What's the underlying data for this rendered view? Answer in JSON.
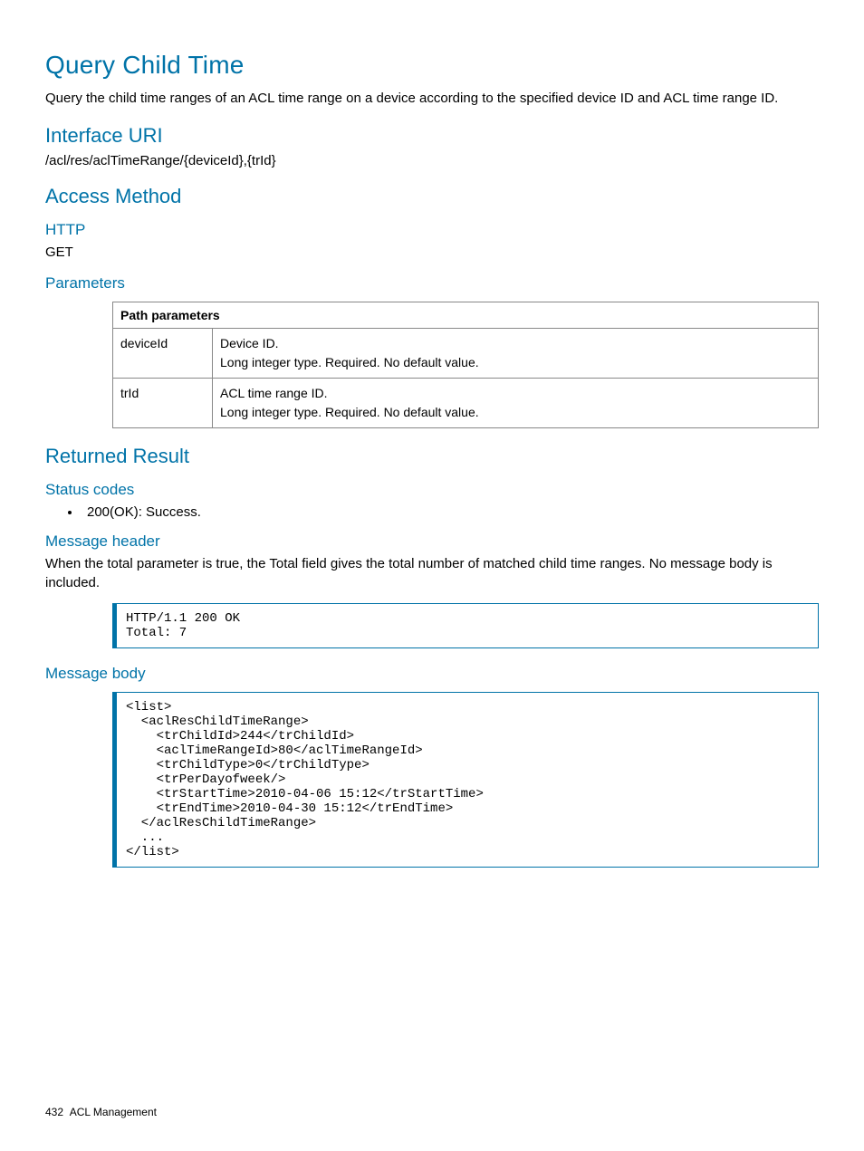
{
  "title": "Query Child Time",
  "intro": "Query the child time ranges of an ACL time range on a device according to the specified device ID and ACL time range ID.",
  "interface": {
    "heading": "Interface URI",
    "uri": "/acl/res/aclTimeRange/{deviceId},{trId}"
  },
  "access": {
    "heading": "Access Method",
    "http_label": "HTTP",
    "method": "GET",
    "parameters_heading": "Parameters",
    "table_header": "Path parameters",
    "rows": [
      {
        "name": "deviceId",
        "desc1": "Device ID.",
        "desc2": "Long integer type. Required. No default value."
      },
      {
        "name": "trId",
        "desc1": "ACL time range ID.",
        "desc2": "Long integer type. Required. No default value."
      }
    ]
  },
  "returned": {
    "heading": "Returned Result",
    "status_heading": "Status codes",
    "status_item": "200(OK): Success.",
    "msg_header_heading": "Message header",
    "msg_header_text": "When the total parameter is true, the Total field gives the total number of matched child time ranges. No message body is included.",
    "msg_header_code": "HTTP/1.1 200 OK\nTotal: 7",
    "msg_body_heading": "Message body",
    "msg_body_code": "<list>\n  <aclResChildTimeRange>\n    <trChildId>244</trChildId>\n    <aclTimeRangeId>80</aclTimeRangeId>\n    <trChildType>0</trChildType>\n    <trPerDayofweek/>\n    <trStartTime>2010-04-06 15:12</trStartTime>\n    <trEndTime>2010-04-30 15:12</trEndTime>\n  </aclResChildTimeRange>\n  ...\n</list>"
  },
  "footer": {
    "page": "432",
    "section": "ACL Management"
  }
}
